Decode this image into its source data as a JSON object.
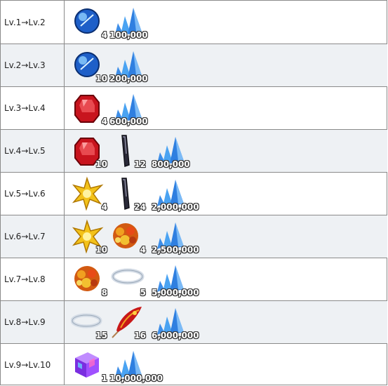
{
  "rows": [
    {
      "level": "Lv.1→Lv.2",
      "items": [
        {
          "icon": "blue-orb-icon",
          "count": "4"
        }
      ],
      "qp": "100,000"
    },
    {
      "level": "Lv.2→Lv.3",
      "items": [
        {
          "icon": "blue-orb-icon",
          "count": "10"
        }
      ],
      "qp": "200,000"
    },
    {
      "level": "Lv.3→Lv.4",
      "items": [
        {
          "icon": "red-gem-icon",
          "count": "4"
        }
      ],
      "qp": "600,000"
    },
    {
      "level": "Lv.4→Lv.5",
      "items": [
        {
          "icon": "red-gem-icon",
          "count": "10"
        },
        {
          "icon": "dark-horn-icon",
          "count": "12"
        }
      ],
      "qp": "800,000"
    },
    {
      "level": "Lv.5→Lv.6",
      "items": [
        {
          "icon": "gold-star-icon",
          "count": "4"
        },
        {
          "icon": "dark-horn-icon",
          "count": "24"
        }
      ],
      "qp": "2,000,000"
    },
    {
      "level": "Lv.6→Lv.7",
      "items": [
        {
          "icon": "gold-star-icon",
          "count": "10"
        },
        {
          "icon": "flower-bouquet-icon",
          "count": "4"
        }
      ],
      "qp": "2,500,000"
    },
    {
      "level": "Lv.7→Lv.8",
      "items": [
        {
          "icon": "flower-bouquet-icon",
          "count": "8"
        },
        {
          "icon": "silver-ring-icon",
          "count": "5"
        }
      ],
      "qp": "5,000,000"
    },
    {
      "level": "Lv.8→Lv.9",
      "items": [
        {
          "icon": "silver-ring-icon",
          "count": "15"
        },
        {
          "icon": "phoenix-feather-icon",
          "count": "16"
        }
      ],
      "qp": "6,000,000"
    },
    {
      "level": "Lv.9→Lv.10",
      "items": [
        {
          "icon": "purple-cube-icon",
          "count": "1"
        }
      ],
      "qp": "10,000,000"
    }
  ]
}
